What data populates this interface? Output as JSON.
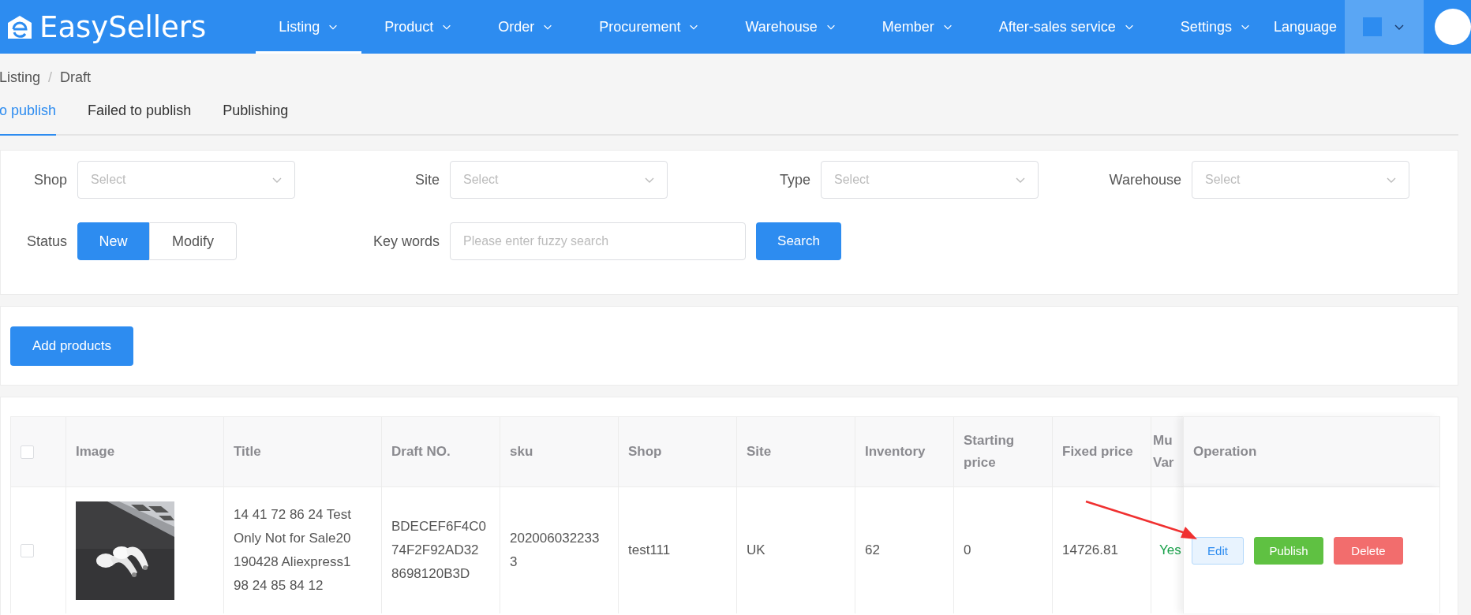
{
  "header": {
    "logo": "EasySellers",
    "nav": [
      {
        "label": "Listing",
        "selected": true
      },
      {
        "label": "Product",
        "selected": false
      },
      {
        "label": "Order",
        "selected": false
      },
      {
        "label": "Procurement",
        "selected": false
      },
      {
        "label": "Warehouse",
        "selected": false
      },
      {
        "label": "Member",
        "selected": false
      },
      {
        "label": "After-sales service",
        "selected": false
      },
      {
        "label": "Settings",
        "selected": false
      }
    ],
    "language": "Language"
  },
  "breadcrumb": [
    "Listing",
    "/",
    "Draft"
  ],
  "tabs": [
    {
      "label": "o publish",
      "selected": true
    },
    {
      "label": "Failed to publish",
      "selected": false
    },
    {
      "label": "Publishing",
      "selected": false
    }
  ],
  "filters": {
    "selects": [
      {
        "label": "Shop",
        "placeholder": "Select"
      },
      {
        "label": "Site",
        "placeholder": "Select"
      },
      {
        "label": "Type",
        "placeholder": "Select"
      },
      {
        "label": "Warehouse",
        "placeholder": "Select"
      }
    ],
    "status": {
      "label": "Status",
      "options": [
        {
          "label": "New",
          "selected": true
        },
        {
          "label": "Modify",
          "selected": false
        }
      ]
    },
    "keywords": {
      "label": "Key words",
      "placeholder": "Please enter fuzzy search"
    },
    "search_button": "Search"
  },
  "add_button": "Add products",
  "table": {
    "all_checked": false,
    "columns": [
      "Image",
      "Title",
      "Draft NO.",
      "sku",
      "Shop",
      "Site",
      "Inventory",
      "Starting price",
      "Fixed price",
      "Mu Var",
      "Operation"
    ],
    "rows": [
      {
        "checked": false,
        "image": {
          "kind": "picture"
        },
        "title": "14 41 72 86 24 Test Only Not for Sale20 190428 Aliexpress1 98 24 85 84 12",
        "draft_no": "BDECEF6F4C0 74F2F92AD32 8698120B3D",
        "sku": "202006032233 3",
        "shop": "test111",
        "site": "UK",
        "inventory": "62",
        "starting_price": "0",
        "fixed_price": "14726.81",
        "multi_variation": "Yes",
        "operations": [
          {
            "label": "Edit",
            "kind": "edit"
          },
          {
            "label": "Publish",
            "kind": "publish"
          },
          {
            "label": "Delete",
            "kind": "delete"
          }
        ]
      }
    ]
  }
}
